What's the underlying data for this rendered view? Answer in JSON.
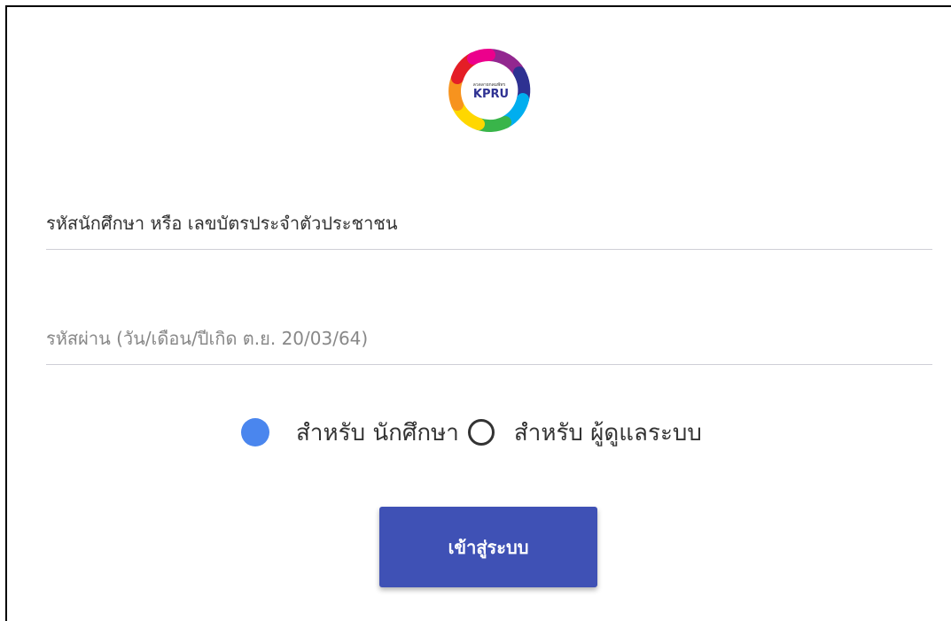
{
  "logo": {
    "text_small": "ลวดลายกลมพัทร",
    "text_main": "KPRU",
    "colors": [
      "#e41e26",
      "#f7931e",
      "#ffd700",
      "#39b54a",
      "#00aeef",
      "#2e3192",
      "#92278f",
      "#ec008c"
    ]
  },
  "form": {
    "username_placeholder": "รหัสนักศึกษา หรือ เลขบัตรประจำตัวประชาชน",
    "password_placeholder": "รหัสผ่าน (วัน/เดือน/ปีเกิด ต.ย. 20/03/64)"
  },
  "roles": {
    "student_label": "สำหรับ นักศึกษา",
    "admin_label": "สำหรับ ผู้ดูแลระบบ",
    "selected": "student"
  },
  "login_button": "เข้าสู่ระบบ",
  "colors": {
    "accent": "#3f51b5",
    "radio_checked": "#4a86ee"
  }
}
